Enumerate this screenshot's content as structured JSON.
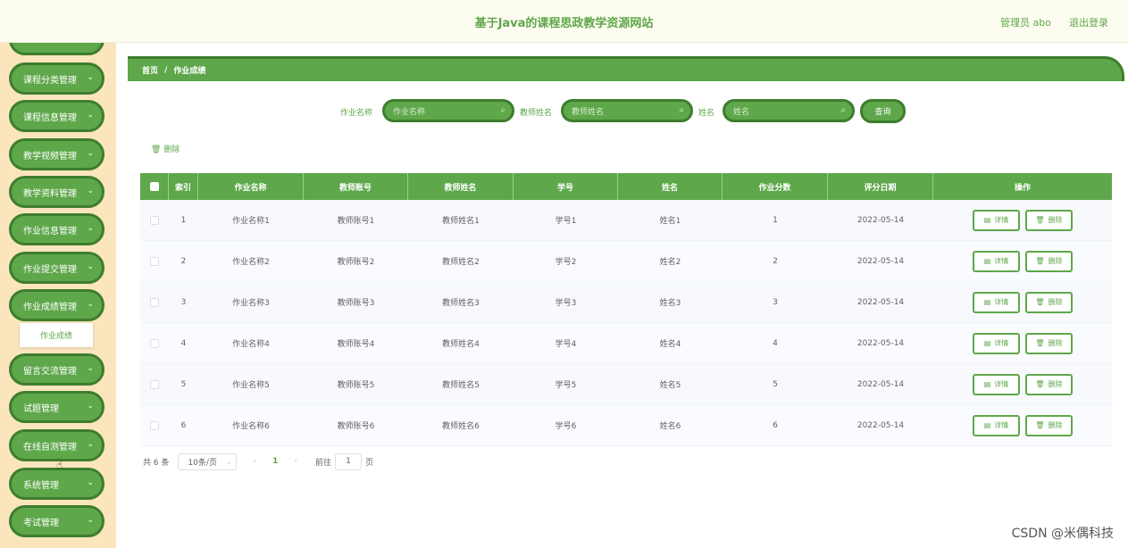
{
  "header": {
    "title": "基于Java的课程思政教学资源网站",
    "user": "管理员 abo",
    "logout": "退出登录"
  },
  "sidebar": {
    "items": [
      {
        "label": "课程分类管理"
      },
      {
        "label": "课程信息管理"
      },
      {
        "label": "教学视频管理"
      },
      {
        "label": "教学资料管理"
      },
      {
        "label": "作业信息管理"
      },
      {
        "label": "作业提交管理"
      },
      {
        "label": "作业成绩管理"
      },
      {
        "label": "留言交流管理"
      },
      {
        "label": "试题管理"
      },
      {
        "label": "在线自测管理"
      },
      {
        "label": "系统管理"
      },
      {
        "label": "考试管理"
      }
    ],
    "submenu": "作业成绩"
  },
  "breadcrumb": {
    "home": "首页",
    "sep": "/",
    "current": "作业成绩"
  },
  "search": {
    "f1_label": "作业名称",
    "f1_placeholder": "作业名称",
    "f2_label": "教师姓名",
    "f2_placeholder": "教师姓名",
    "f3_label": "姓名",
    "f3_placeholder": "姓名",
    "button": "查询"
  },
  "toolbar": {
    "delete": "删除"
  },
  "table": {
    "headers": [
      "索引",
      "作业名称",
      "教师账号",
      "教师姓名",
      "学号",
      "姓名",
      "作业分数",
      "评分日期",
      "操作"
    ],
    "rows": [
      [
        "1",
        "作业名称1",
        "教师账号1",
        "教师姓名1",
        "学号1",
        "姓名1",
        "1",
        "2022-05-14"
      ],
      [
        "2",
        "作业名称2",
        "教师账号2",
        "教师姓名2",
        "学号2",
        "姓名2",
        "2",
        "2022-05-14"
      ],
      [
        "3",
        "作业名称3",
        "教师账号3",
        "教师姓名3",
        "学号3",
        "姓名3",
        "3",
        "2022-05-14"
      ],
      [
        "4",
        "作业名称4",
        "教师账号4",
        "教师姓名4",
        "学号4",
        "姓名4",
        "4",
        "2022-05-14"
      ],
      [
        "5",
        "作业名称5",
        "教师账号5",
        "教师姓名5",
        "学号5",
        "姓名5",
        "5",
        "2022-05-14"
      ],
      [
        "6",
        "作业名称6",
        "教师账号6",
        "教师姓名6",
        "学号6",
        "姓名6",
        "6",
        "2022-05-14"
      ]
    ],
    "detail_label": "详情",
    "delete_label": "删除"
  },
  "pagination": {
    "total": "共 6 条",
    "page_size": "10条/页",
    "current": "1",
    "goto": "前往",
    "page_input": "1",
    "page_suffix": "页"
  },
  "watermark": "CSDN @米偶科技"
}
